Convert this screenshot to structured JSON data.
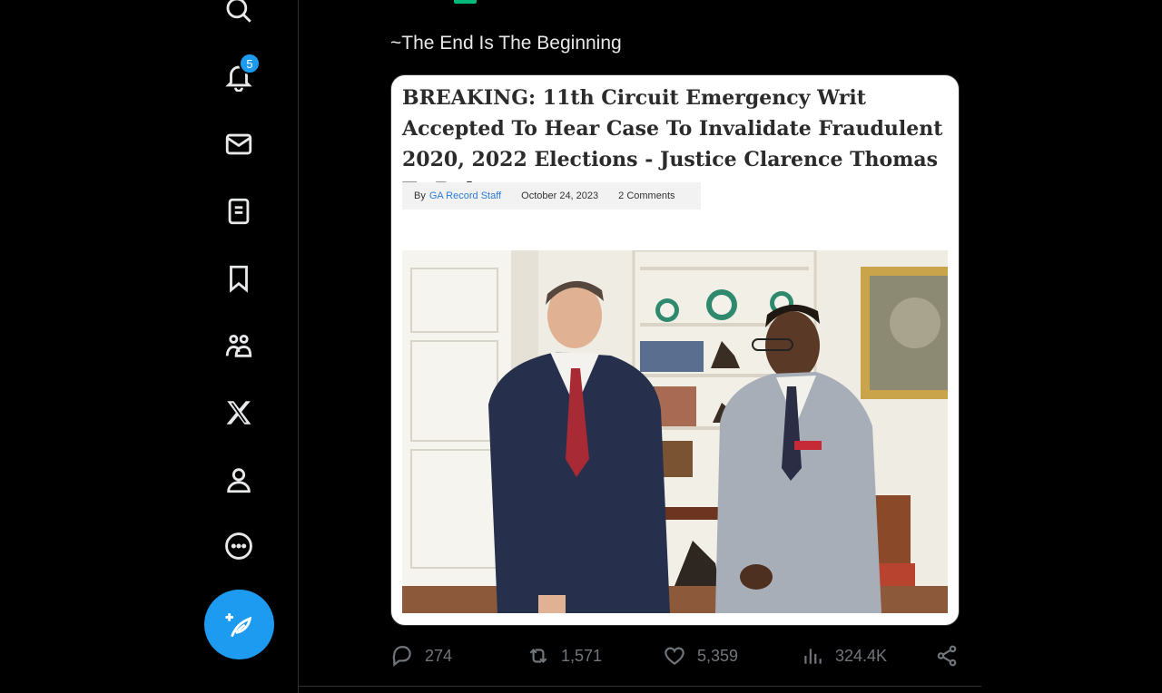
{
  "sidebar": {
    "notifications_badge": "5",
    "items": [
      {
        "name": "search"
      },
      {
        "name": "notifications"
      },
      {
        "name": "messages"
      },
      {
        "name": "lists"
      },
      {
        "name": "bookmarks"
      },
      {
        "name": "communities"
      },
      {
        "name": "premium-x"
      },
      {
        "name": "profile"
      },
      {
        "name": "more"
      }
    ]
  },
  "tweet": {
    "text": "~The End Is The Beginning",
    "media": {
      "headline": "BREAKING: 11th Circuit Emergency Writ Accepted To Hear Case To Invalidate Fraudulent 2020, 2022 Elections - Justice Clarence Thomas To Rule",
      "by_label": "By",
      "author": "GA Record Staff",
      "date": "October 24, 2023",
      "comments": "2 Comments"
    },
    "actions": {
      "replies": "274",
      "reposts": "1,571",
      "likes": "5,359",
      "views": "324.4K"
    }
  },
  "colors": {
    "accent": "#1d9bf0",
    "muted": "#71767b",
    "background": "#000000"
  }
}
